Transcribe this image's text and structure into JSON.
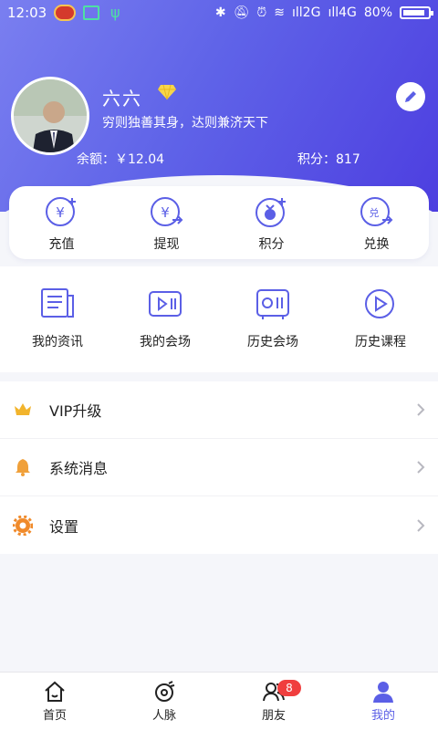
{
  "status_bar": {
    "time": "12:03",
    "network1": "2G",
    "network2": "4G",
    "battery": "80%"
  },
  "profile": {
    "name": "六六",
    "motto": "穷则独善其身，达则兼济天下",
    "balance": "余额：￥12.04",
    "points": "积分：817",
    "badge_icon": "diamond-icon",
    "edit_icon": "pencil-icon"
  },
  "quick_actions": [
    {
      "label": "充值",
      "icon": "recharge-icon"
    },
    {
      "label": "提现",
      "icon": "withdraw-icon"
    },
    {
      "label": "积分",
      "icon": "points-icon"
    },
    {
      "label": "兑换",
      "icon": "exchange-icon"
    }
  ],
  "media_items": [
    {
      "label": "我的资讯",
      "icon": "news-icon"
    },
    {
      "label": "我的会场",
      "icon": "my-venue-icon"
    },
    {
      "label": "历史会场",
      "icon": "history-venue-icon"
    },
    {
      "label": "历史课程",
      "icon": "history-course-icon"
    }
  ],
  "menu": [
    {
      "label": "VIP升级",
      "icon": "crown-icon"
    },
    {
      "label": "系统消息",
      "icon": "bell-icon"
    },
    {
      "label": "设置",
      "icon": "gear-icon"
    }
  ],
  "bottom_nav": [
    {
      "label": "首页",
      "icon": "home-icon"
    },
    {
      "label": "人脉",
      "icon": "contacts-icon"
    },
    {
      "label": "朋友",
      "icon": "friends-icon",
      "badge": "8"
    },
    {
      "label": "我的",
      "icon": "profile-icon",
      "active": true
    }
  ],
  "colors": {
    "accent": "#5b5fe6",
    "header_start": "#7a7ff0",
    "header_end": "#4d3ee0",
    "badge": "#f03e3e",
    "crown": "#f2b42c",
    "bell": "#f0a03a",
    "gear": "#f08a2a"
  }
}
